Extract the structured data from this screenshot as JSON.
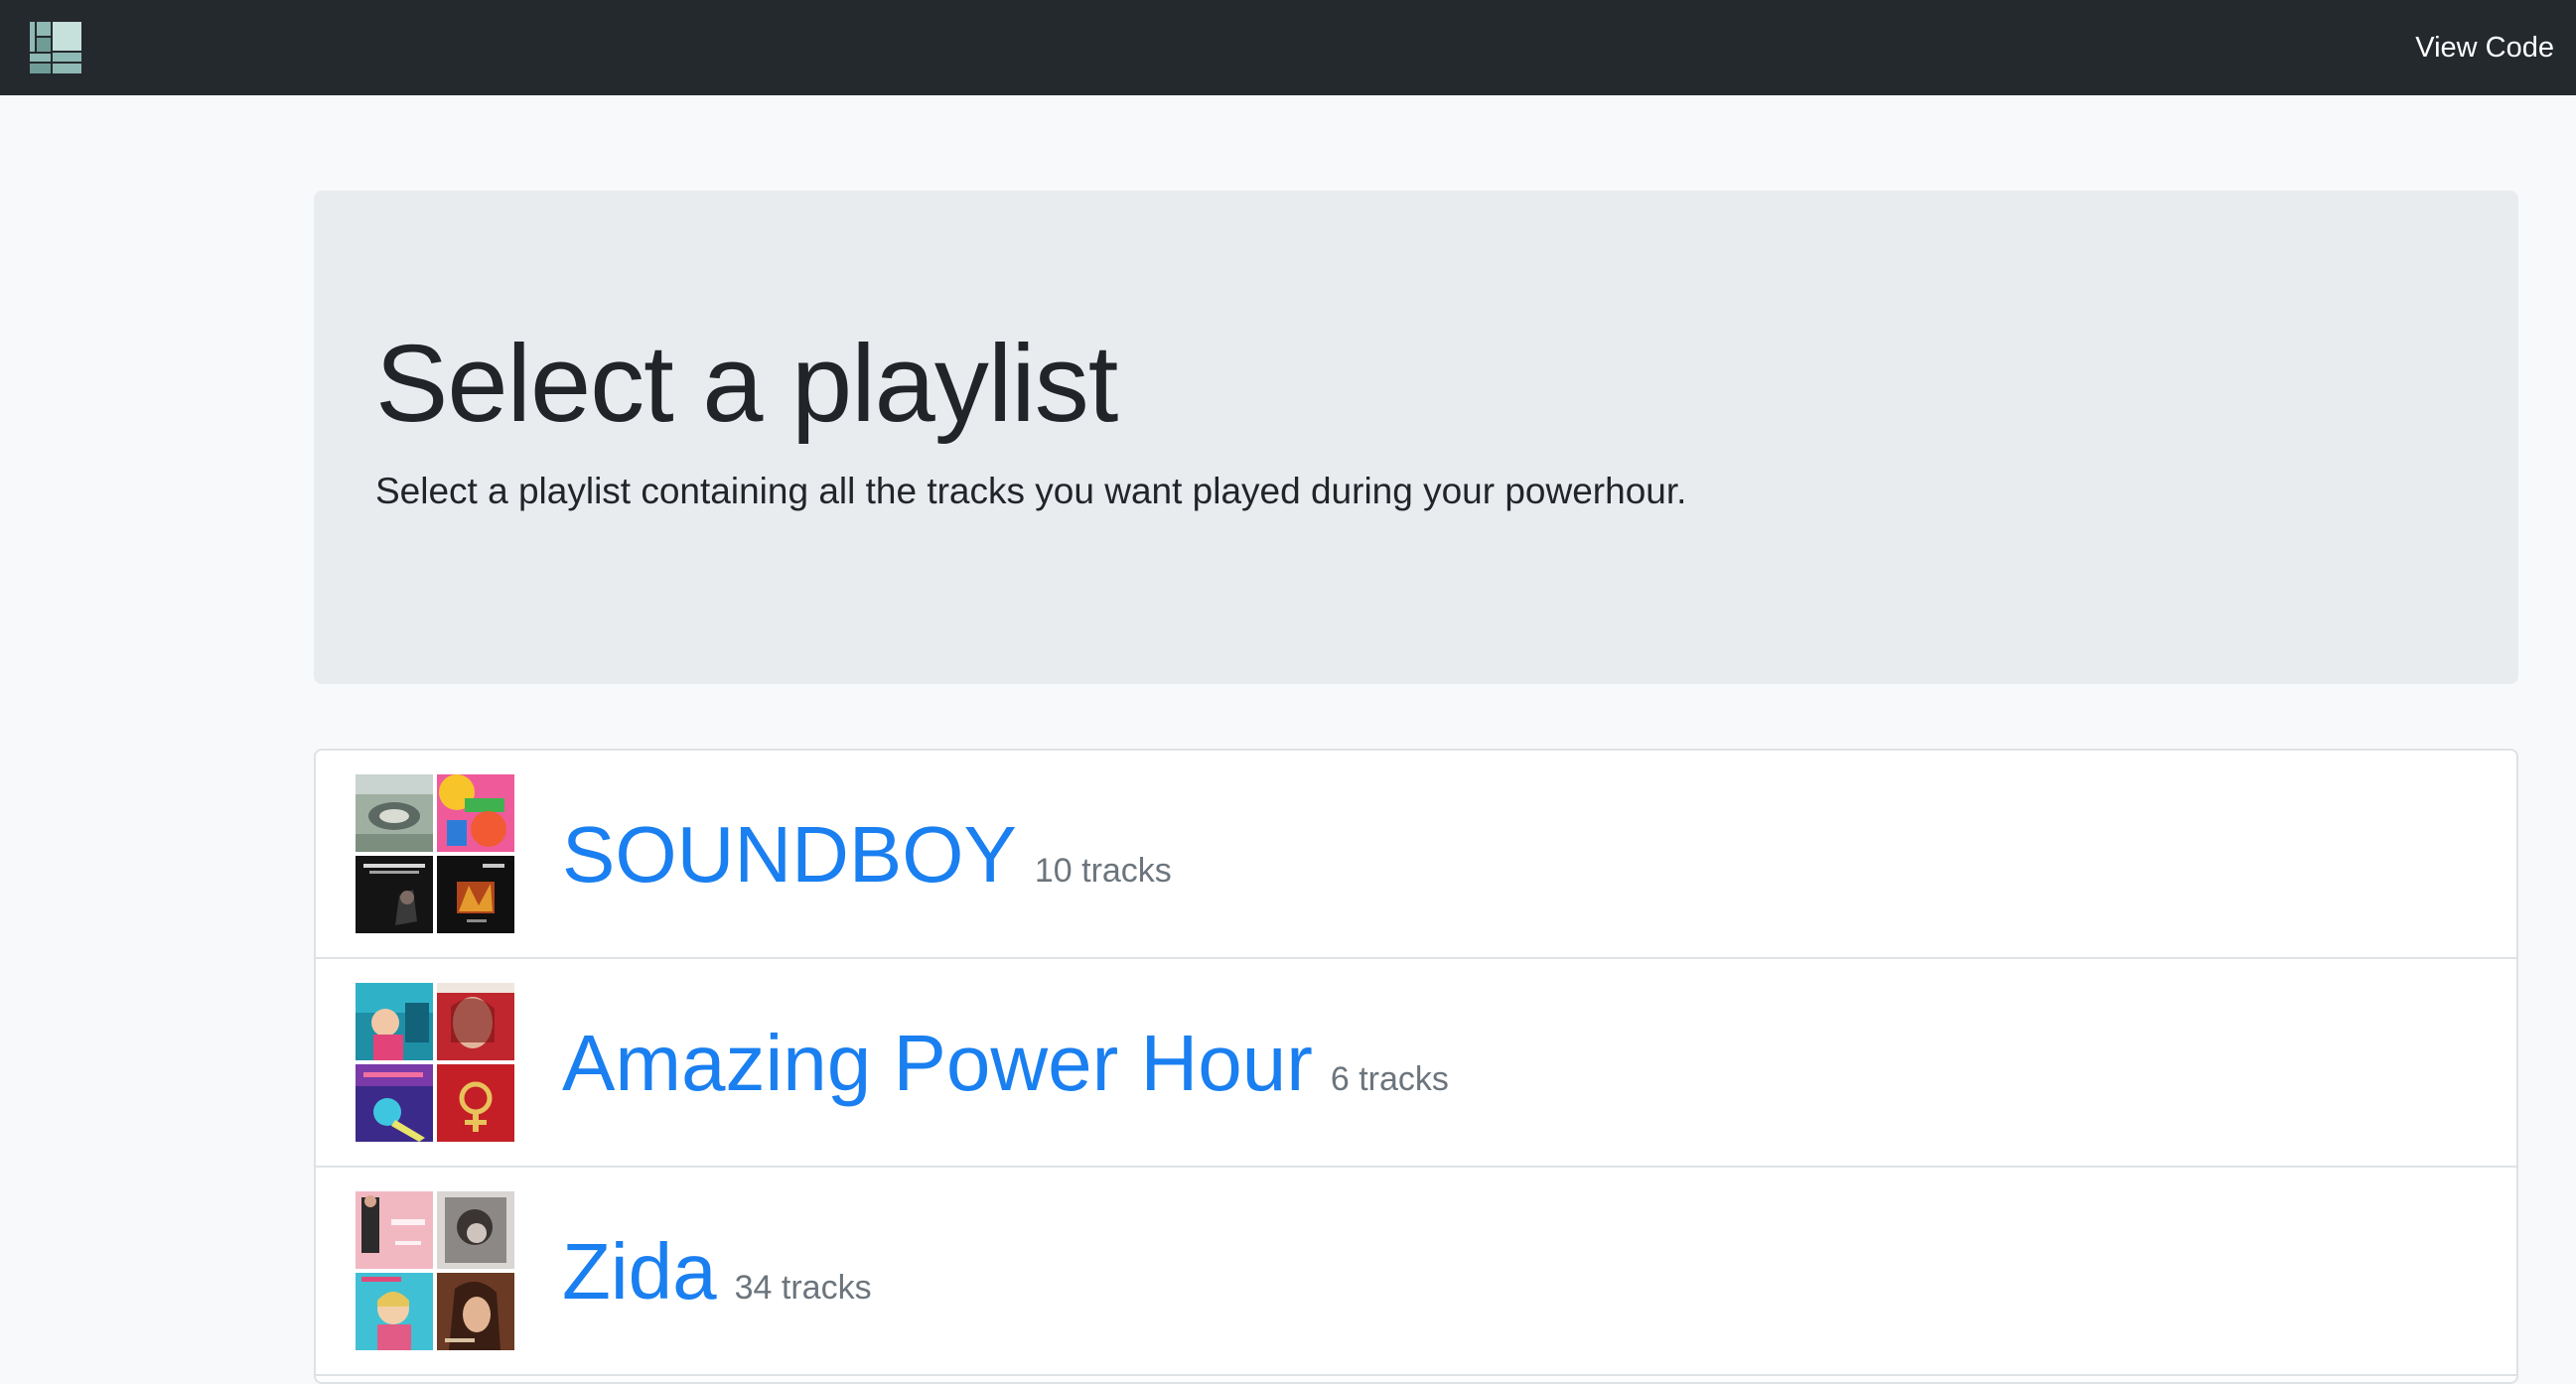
{
  "nav": {
    "view_code_label": "View Code"
  },
  "jumbotron": {
    "title": "Select a playlist",
    "lead": "Select a playlist containing all the tracks you want played during your powerhour."
  },
  "playlists": [
    {
      "name": "SOUNDBOY",
      "track_count": "10 tracks"
    },
    {
      "name": "Amazing Power Hour",
      "track_count": "6 tracks"
    },
    {
      "name": "Zida",
      "track_count": "34 tracks"
    }
  ],
  "colors": {
    "navbar": "#24292e",
    "link_blue": "#1a7ff0",
    "muted": "#6c757d",
    "jumbotron_bg": "#e9ecef",
    "page_bg": "#f8f9fa"
  },
  "icons": [
    "app-logo-icon"
  ]
}
